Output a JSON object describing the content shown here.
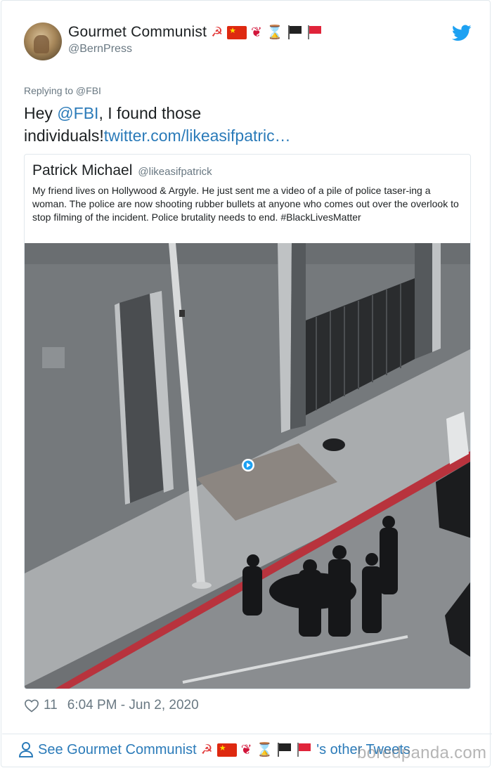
{
  "author": {
    "display_name": "Gourmet Communist",
    "emojis": [
      "hammer-sickle",
      "china-flag",
      "rose",
      "hourglass",
      "black-flag",
      "red-flag"
    ],
    "handle": "@BernPress"
  },
  "tweet": {
    "replying_to": "Replying to @FBI",
    "text_part1": "Hey ",
    "mention": "@FBI",
    "text_part2": ", I found those individuals!",
    "link": "twitter.com/likeasifpatric…"
  },
  "quoted_tweet": {
    "name": "Patrick Michael",
    "handle": "@likeasifpatrick",
    "text": "My friend lives on Hollywood & Argyle. He just sent me a video of a pile of police taser-ing a woman. The police are now shooting rubber bullets at anyone who comes out over the overlook to stop filming of the incident. Police brutality needs to end. #BlackLivesMatter"
  },
  "meta": {
    "likes": "11",
    "timestamp": "6:04 PM - Jun 2, 2020"
  },
  "footer": {
    "see_prefix": "See Gourmet Communist",
    "see_suffix": "'s other Tweets"
  },
  "watermark": "boredpanda.com",
  "colors": {
    "link": "#2b7bb9",
    "text": "#1c2022",
    "muted": "#697882",
    "border": "#e1e8ed",
    "twitter_blue": "#1da1f2"
  }
}
